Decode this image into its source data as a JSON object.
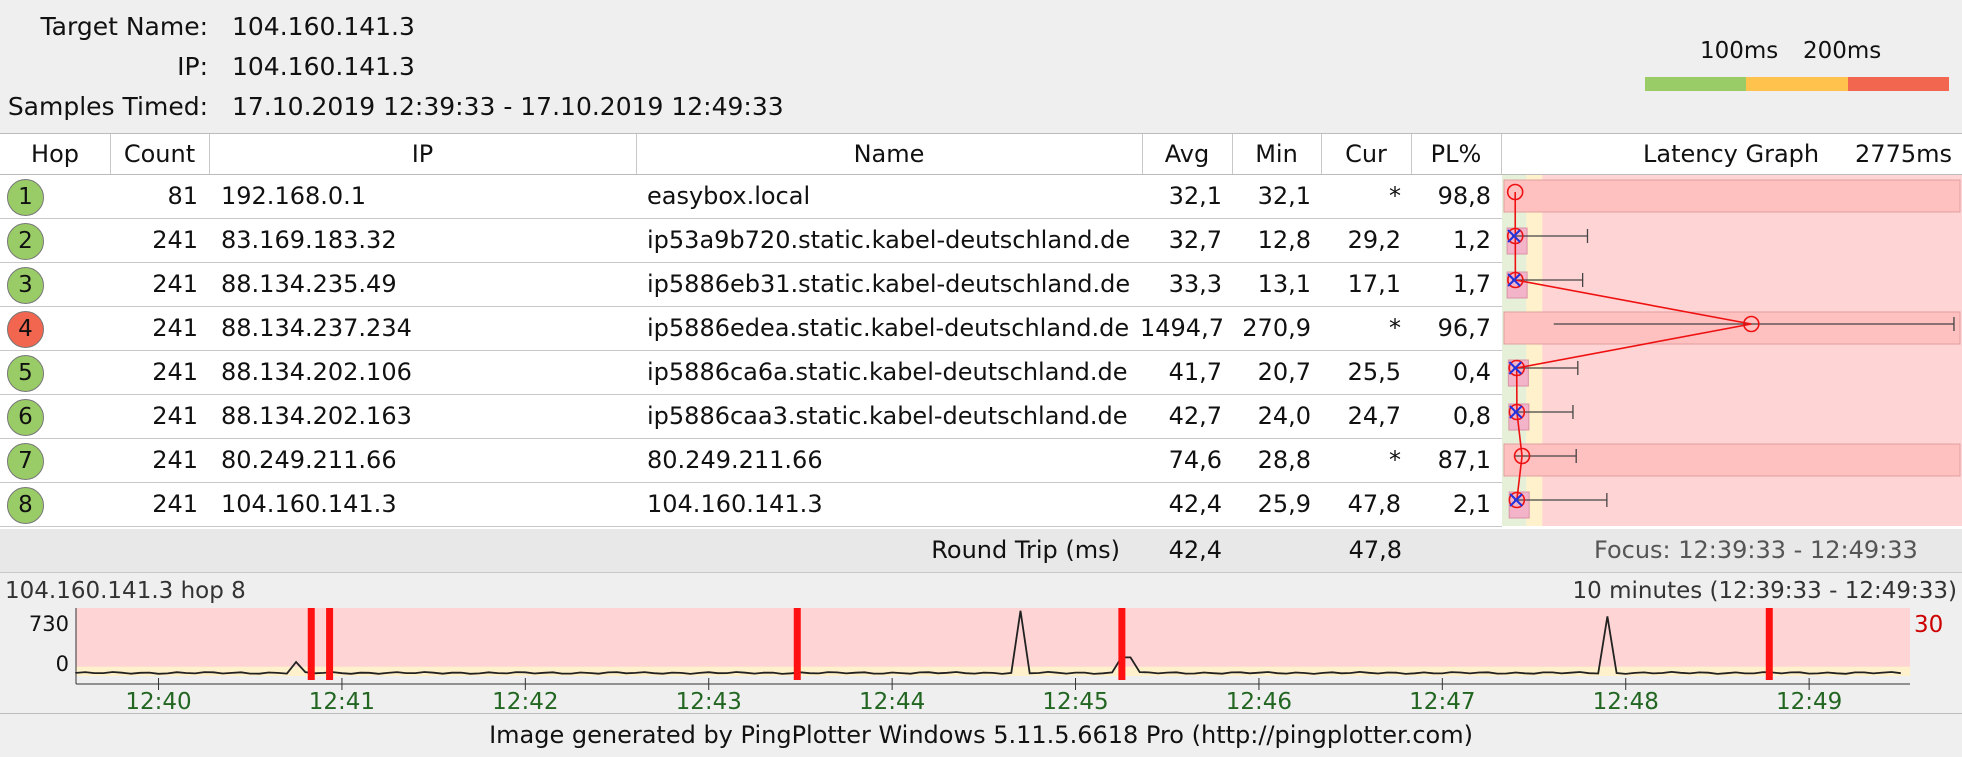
{
  "header": {
    "target_name_label": "Target Name:",
    "target_name_value": "104.160.141.3",
    "ip_label": "IP:",
    "ip_value": "104.160.141.3",
    "samples_label": "Samples Timed:",
    "samples_value": "17.10.2019 12:39:33 - 17.10.2019 12:49:33"
  },
  "legend": {
    "label_100": "100ms",
    "label_200": "200ms",
    "colors": {
      "good": "#99cc66",
      "warn": "#ffc34d",
      "bad": "#f26650"
    }
  },
  "columns": {
    "hop": "Hop",
    "count": "Count",
    "ip": "IP",
    "name": "Name",
    "avg": "Avg",
    "min": "Min",
    "cur": "Cur",
    "pl": "PL%",
    "graph": "Latency Graph",
    "graph_max": "2775ms"
  },
  "hops": [
    {
      "hop": "1",
      "count": "81",
      "ip": "192.168.0.1",
      "name": "easybox.local",
      "avg": "32,1",
      "min": "32,1",
      "cur": "*",
      "pl": "98,8",
      "status": "ok",
      "avg_ms": 32.1,
      "min_ms": 32.1,
      "max_ms": null,
      "pl_num": 98.8
    },
    {
      "hop": "2",
      "count": "241",
      "ip": "83.169.183.32",
      "name": "ip53a9b720.static.kabel-deutschland.de",
      "avg": "32,7",
      "min": "12,8",
      "cur": "29,2",
      "pl": "1,2",
      "status": "ok",
      "avg_ms": 32.7,
      "min_ms": 12.8,
      "max_ms": 480,
      "pl_num": 1.2
    },
    {
      "hop": "3",
      "count": "241",
      "ip": "88.134.235.49",
      "name": "ip5886eb31.static.kabel-deutschland.de",
      "avg": "33,3",
      "min": "13,1",
      "cur": "17,1",
      "pl": "1,7",
      "status": "ok",
      "avg_ms": 33.3,
      "min_ms": 13.1,
      "max_ms": 450,
      "pl_num": 1.7
    },
    {
      "hop": "4",
      "count": "241",
      "ip": "88.134.237.234",
      "name": "ip5886edea.static.kabel-deutschland.de",
      "avg": "1494,7",
      "min": "270,9",
      "cur": "*",
      "pl": "96,7",
      "status": "bad",
      "avg_ms": 1494.7,
      "min_ms": 270.9,
      "max_ms": 2750,
      "pl_num": 96.7
    },
    {
      "hop": "5",
      "count": "241",
      "ip": "88.134.202.106",
      "name": "ip5886ca6a.static.kabel-deutschland.de",
      "avg": "41,7",
      "min": "20,7",
      "cur": "25,5",
      "pl": "0,4",
      "status": "ok",
      "avg_ms": 41.7,
      "min_ms": 20.7,
      "max_ms": 420,
      "pl_num": 0.4
    },
    {
      "hop": "6",
      "count": "241",
      "ip": "88.134.202.163",
      "name": "ip5886caa3.static.kabel-deutschland.de",
      "avg": "42,7",
      "min": "24,0",
      "cur": "24,7",
      "pl": "0,8",
      "status": "ok",
      "avg_ms": 42.7,
      "min_ms": 24.0,
      "max_ms": 390,
      "pl_num": 0.8
    },
    {
      "hop": "7",
      "count": "241",
      "ip": "80.249.211.66",
      "name": "80.249.211.66",
      "avg": "74,6",
      "min": "28,8",
      "cur": "*",
      "pl": "87,1",
      "status": "ok",
      "avg_ms": 74.6,
      "min_ms": 28.8,
      "max_ms": 410,
      "pl_num": 87.1
    },
    {
      "hop": "8",
      "count": "241",
      "ip": "104.160.141.3",
      "name": "104.160.141.3",
      "avg": "42,4",
      "min": "25,9",
      "cur": "47,8",
      "pl": "2,1",
      "status": "ok",
      "avg_ms": 42.4,
      "min_ms": 25.9,
      "max_ms": 600,
      "pl_num": 2.1
    }
  ],
  "summary": {
    "label": "Round Trip (ms)",
    "avg": "42,4",
    "cur": "47,8",
    "focus": "Focus: 12:39:33 - 12:49:33"
  },
  "timeline": {
    "title": "104.160.141.3 hop 8",
    "range": "10 minutes (12:39:33 - 12:49:33)",
    "y_top": "730",
    "y_bottom": "0",
    "right_scale": "30",
    "ticks": [
      "12:40",
      "12:41",
      "12:42",
      "12:43",
      "12:44",
      "12:45",
      "12:46",
      "12:47",
      "12:48",
      "12:49"
    ],
    "tick_minutes": [
      0.45,
      1.45,
      2.45,
      3.45,
      4.45,
      5.45,
      6.45,
      7.45,
      8.45,
      9.45
    ],
    "loss_minutes": [
      1.28,
      1.38,
      3.93,
      5.7,
      9.23
    ],
    "spikes": [
      {
        "min": 1.22,
        "ms": 150
      },
      {
        "min": 5.15,
        "ms": 700
      },
      {
        "min": 5.72,
        "ms": 200
      },
      {
        "min": 8.35,
        "ms": 640
      }
    ]
  },
  "footer": {
    "text": "Image generated by PingPlotter Windows 5.11.5.6618 Pro (http://pingplotter.com)"
  }
}
